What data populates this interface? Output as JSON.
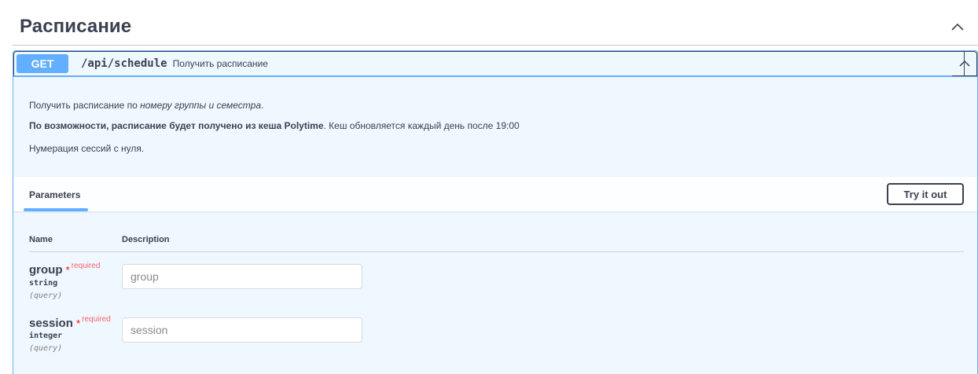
{
  "tag": {
    "title": "Расписание"
  },
  "operation": {
    "method": "GET",
    "path": "/api/schedule",
    "summary": "Получить расписание"
  },
  "description": {
    "line1_plain": "Получить расписание по ",
    "line1_italic": "номеру группы и семестра",
    "line1_end": ".",
    "line2_bold": "По возможности, расписание будет получено из кеша Polytime",
    "line2_rest": ". Кеш обновляется каждый день после 19:00",
    "line3": "Нумерация сессий с нуля."
  },
  "parameters": {
    "tab_label": "Parameters",
    "try_button": "Try it out",
    "col_name": "Name",
    "col_description": "Description",
    "required_star": "*",
    "required_label": "required",
    "items": [
      {
        "name": "group",
        "type": "string",
        "in": "(query)",
        "placeholder": "group"
      },
      {
        "name": "session",
        "type": "integer",
        "in": "(query)",
        "placeholder": "session"
      }
    ]
  },
  "colors": {
    "get": "#61affe",
    "text": "#3b4151",
    "required": "#ff0000"
  },
  "icons": {
    "collapse": "chevron-up-icon"
  }
}
